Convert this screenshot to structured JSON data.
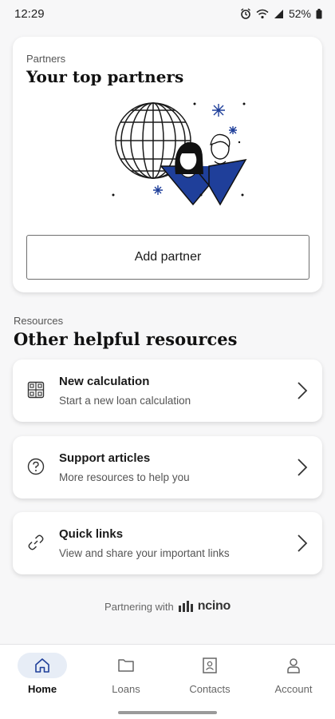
{
  "status_bar": {
    "time": "12:29",
    "battery": "52%",
    "icons": [
      "alarm-icon",
      "wifi-icon",
      "signal-icon",
      "battery-icon"
    ]
  },
  "partners": {
    "eyebrow": "Partners",
    "title": "Your top partners",
    "add_button_label": "Add partner",
    "illustration": "globe-people-illustration"
  },
  "resources": {
    "eyebrow": "Resources",
    "title": "Other helpful resources",
    "items": [
      {
        "title": "New calculation",
        "subtitle": "Start a new loan calculation",
        "icon": "calculator-icon"
      },
      {
        "title": "Support articles",
        "subtitle": "More resources to help you",
        "icon": "help-circle-icon"
      },
      {
        "title": "Quick links",
        "subtitle": "View and share your important links",
        "icon": "link-icon"
      }
    ]
  },
  "footer": {
    "partnering_text": "Partnering with",
    "brand": "ncino"
  },
  "bottom_nav": {
    "items": [
      {
        "label": "Home",
        "icon": "home-icon",
        "active": true
      },
      {
        "label": "Loans",
        "icon": "folder-icon",
        "active": false
      },
      {
        "label": "Contacts",
        "icon": "contact-card-icon",
        "active": false
      },
      {
        "label": "Account",
        "icon": "person-icon",
        "active": false
      }
    ]
  },
  "colors": {
    "accent_navy": "#1f3f9a",
    "active_nav_bg": "#e7edf6",
    "background": "#f7f7f8"
  }
}
